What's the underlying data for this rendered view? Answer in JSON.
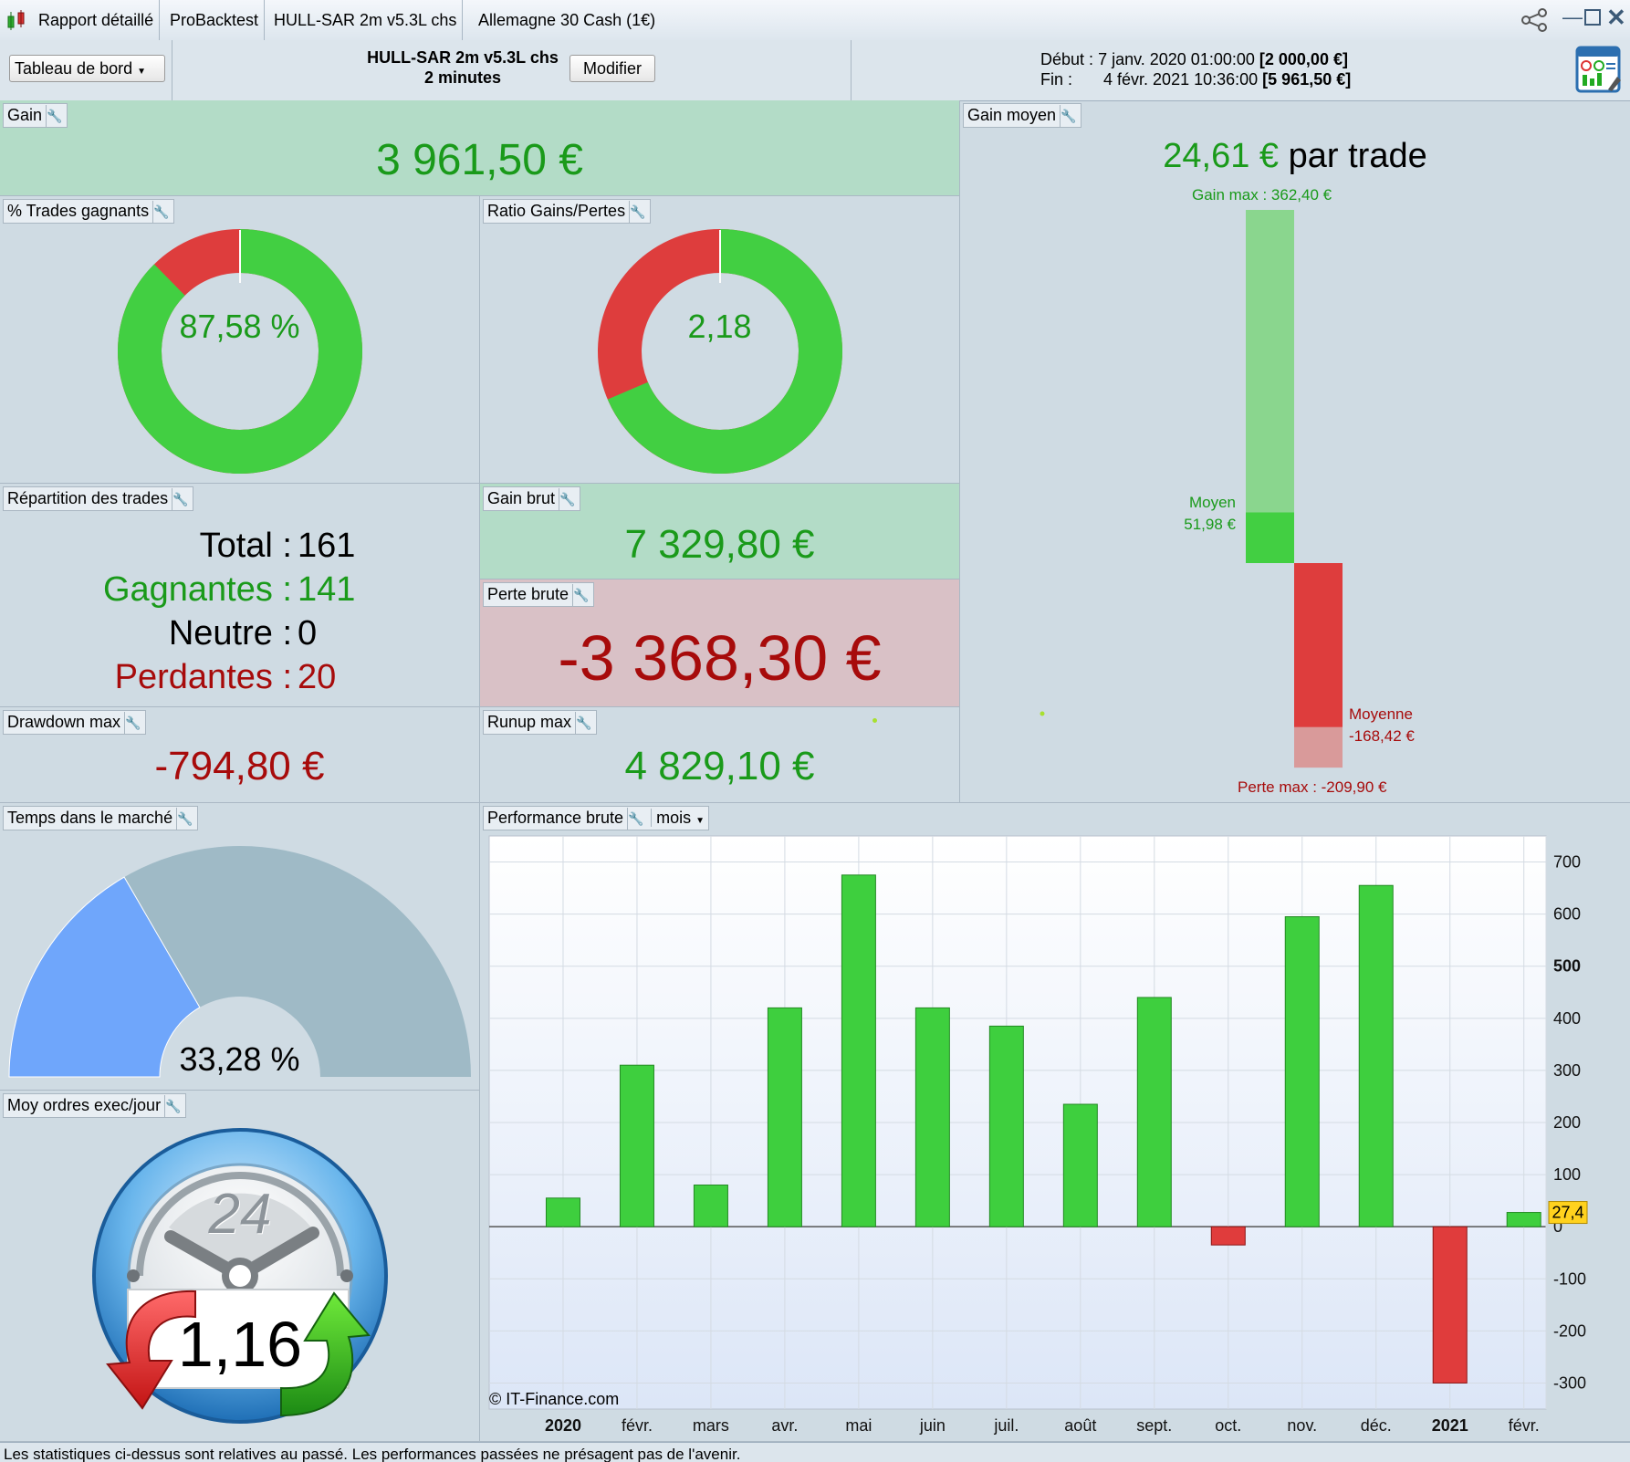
{
  "titlebar": {
    "tabs": [
      "Rapport détaillé",
      "ProBacktest",
      "HULL-SAR 2m v5.3L chs",
      "Allemagne 30 Cash (1€)"
    ]
  },
  "header": {
    "dashboard_label": "Tableau de bord",
    "strategy_name": "HULL-SAR 2m v5.3L chs",
    "timeframe": "2 minutes",
    "modify_label": "Modifier",
    "start_label": "Début :",
    "start_value": "7 janv. 2020 01:00:00",
    "start_amount": "[2 000,00 €]",
    "end_label": "Fin :",
    "end_value": "4 févr. 2021 10:36:00",
    "end_amount": "[5 961,50 €]"
  },
  "gain": {
    "label": "Gain",
    "value": "3 961,50 €"
  },
  "winning_trades": {
    "label": "% Trades gagnants",
    "value": "87,58 %",
    "fraction": 0.8758
  },
  "ratio": {
    "label": "Ratio Gains/Pertes",
    "value": "2,18",
    "win_fraction": 0.6855
  },
  "gain_moyen": {
    "label": "Gain moyen",
    "value": "24,61 €",
    "suffix": "par trade",
    "gain_max_label": "Gain max : 362,40 €",
    "moyen_label": "Moyen",
    "moyen_value": "51,98 €",
    "moyenne_label": "Moyenne",
    "moyenne_value": "-168,42 €",
    "perte_max_label": "Perte max : -209,90 €",
    "gain_max": 362.4,
    "moyen": 51.98,
    "moyenne": -168.42,
    "perte_max": -209.9
  },
  "repartition": {
    "label": "Répartition des trades",
    "total_label": "Total :",
    "total_value": "161",
    "gagnantes_label": "Gagnantes :",
    "gagnantes_value": "141",
    "neutre_label": "Neutre :",
    "neutre_value": "0",
    "perdantes_label": "Perdantes :",
    "perdantes_value": "20"
  },
  "gain_brut": {
    "label": "Gain brut",
    "value": "7 329,80 €"
  },
  "perte_brute": {
    "label": "Perte brute",
    "value": "-3 368,30 €"
  },
  "drawdown": {
    "label": "Drawdown max",
    "value": "-794,80 €"
  },
  "runup": {
    "label": "Runup max",
    "value": "4 829,10 €"
  },
  "temps": {
    "label": "Temps dans le marché",
    "value": "33,28 %",
    "fraction": 0.3328
  },
  "ordres": {
    "label": "Moy ordres exec/jour",
    "value": "1,16",
    "hours": "24"
  },
  "performance": {
    "label": "Performance brute",
    "period": "mois",
    "copyright": "© IT-Finance.com",
    "last_value_label": "27,4"
  },
  "chart_data": {
    "type": "bar",
    "categories": [
      "2020",
      "févr.",
      "mars",
      "avr.",
      "mai",
      "juin",
      "juil.",
      "août",
      "sept.",
      "oct.",
      "nov.",
      "déc.",
      "2021",
      "févr."
    ],
    "values": [
      55,
      310,
      80,
      420,
      675,
      420,
      385,
      235,
      440,
      -35,
      595,
      655,
      -300,
      27.4
    ],
    "ylim": [
      -350,
      750
    ],
    "yticks": [
      700,
      600,
      500,
      400,
      300,
      200,
      100,
      0,
      -100,
      -200,
      -300
    ],
    "bold_categories": [
      "2020",
      "2021"
    ],
    "positive_color": "#3ecf3e",
    "negative_color": "#e03c3c",
    "grid": true
  },
  "colors": {
    "green_fill": "#42cf42",
    "red_fill": "#de3d3d",
    "green_text": "#1a9a1a",
    "red_text": "#a70b0b",
    "gain_bg": "#b3dcc7",
    "loss_bg": "#d9c1c6"
  },
  "footer": {
    "disclaimer": "Les statistiques ci-dessus sont relatives au passé. Les performances passées ne présagent pas de l'avenir."
  }
}
